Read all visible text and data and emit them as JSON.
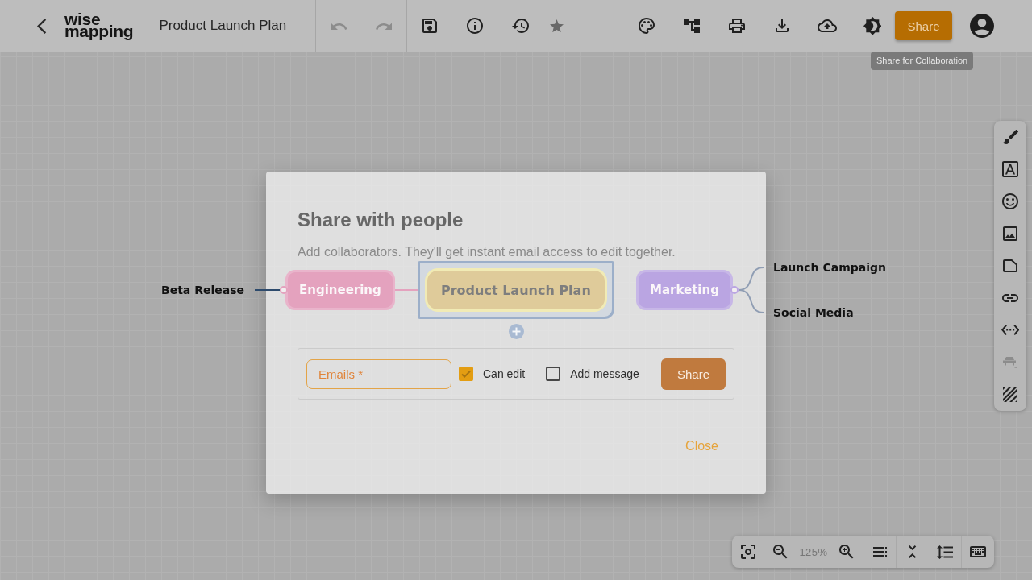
{
  "toolbar": {
    "logo_lines": [
      "wise",
      "mapping"
    ],
    "title": "Product Launch Plan",
    "edit_tools": [
      {
        "kind": "undo",
        "disabled": true
      },
      {
        "kind": "redo",
        "disabled": true
      }
    ],
    "map_tools": [
      {
        "kind": "save",
        "disabled": false
      },
      {
        "kind": "info",
        "disabled": false
      },
      {
        "kind": "history",
        "disabled": false
      },
      {
        "kind": "star",
        "disabled": false,
        "starred": false
      }
    ],
    "actions": [
      {
        "kind": "palette",
        "disabled": false
      },
      {
        "kind": "layout",
        "disabled": false
      },
      {
        "kind": "print",
        "disabled": false
      },
      {
        "kind": "download",
        "disabled": false
      },
      {
        "kind": "publish",
        "disabled": false
      },
      {
        "kind": "theme",
        "disabled": false
      }
    ],
    "share_button": {
      "label": "Share"
    },
    "tooltip": {
      "text": "Share for Collaboration"
    }
  },
  "style_toolbar": {
    "tools": [
      {
        "kind": "brush",
        "disabled": false
      },
      {
        "kind": "font",
        "disabled": false
      },
      {
        "kind": "emoji",
        "disabled": false
      },
      {
        "kind": "image",
        "disabled": false
      },
      {
        "kind": "note",
        "disabled": false
      },
      {
        "kind": "link",
        "disabled": false
      },
      {
        "kind": "relation",
        "disabled": false
      },
      {
        "kind": "shape",
        "disabled": true
      },
      {
        "kind": "pattern",
        "disabled": false
      }
    ]
  },
  "mind_map": {
    "central_topic": {
      "text": "Product Launch Plan",
      "selected": true,
      "left_branches": [
        {
          "text": "Engineering",
          "color": "#e4a2be",
          "children": [
            {
              "text": "Beta Release"
            }
          ]
        }
      ],
      "right_branches": [
        {
          "text": "Marketing",
          "color": "#baa5e2",
          "children": [
            {
              "text": "Launch Campaign"
            },
            {
              "text": "Social Media"
            }
          ]
        }
      ]
    }
  },
  "share_dialog": {
    "title": "Share with people",
    "description": "Add collaborators. They'll get instant email access to edit together.",
    "email_field": {
      "placeholder": "Emails *"
    },
    "options": [
      {
        "label": "Can edit",
        "checked": true
      },
      {
        "label": "Add message",
        "checked": false
      }
    ],
    "share_button": {
      "label": "Share"
    },
    "close_button": {
      "label": "Close"
    }
  },
  "zoom_toolbar": {
    "groups": [
      {
        "items": [
          {
            "kind": "fit"
          },
          {
            "kind": "zoom_out"
          },
          {
            "kind": "zoom_level",
            "text": "125%"
          },
          {
            "kind": "zoom_in"
          }
        ]
      },
      {
        "items": [
          {
            "kind": "outline"
          }
        ]
      },
      {
        "items": [
          {
            "kind": "collapse"
          },
          {
            "kind": "line_spacing"
          }
        ]
      },
      {
        "items": [
          {
            "kind": "keyboard"
          }
        ]
      }
    ]
  }
}
